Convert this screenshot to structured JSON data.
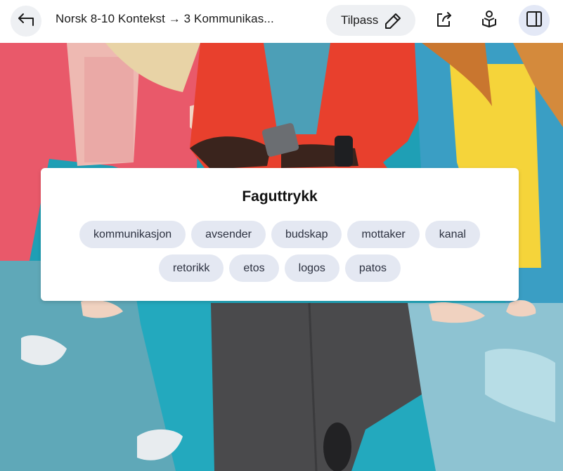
{
  "header": {
    "breadcrumb": "Norsk 8-10 Kontekst → 3 Kommunikas...",
    "customize_label": "Tilpass"
  },
  "card": {
    "title": "Faguttrykk",
    "terms_row1": [
      "kommunikasjon",
      "avsender",
      "budskap",
      "mottaker",
      "kanal"
    ],
    "terms_row2": [
      "retorikk",
      "etos",
      "logos",
      "patos"
    ]
  },
  "icons": {
    "back": "arrow-back-icon",
    "customize": "pencil-icon",
    "share": "share-icon",
    "reader": "reader-icon",
    "panel": "side-panel-icon"
  },
  "colors": {
    "chip_bg": "#e4e8f2",
    "panel_button_bg": "#e3e8f6",
    "button_bg": "#eef0f3"
  }
}
